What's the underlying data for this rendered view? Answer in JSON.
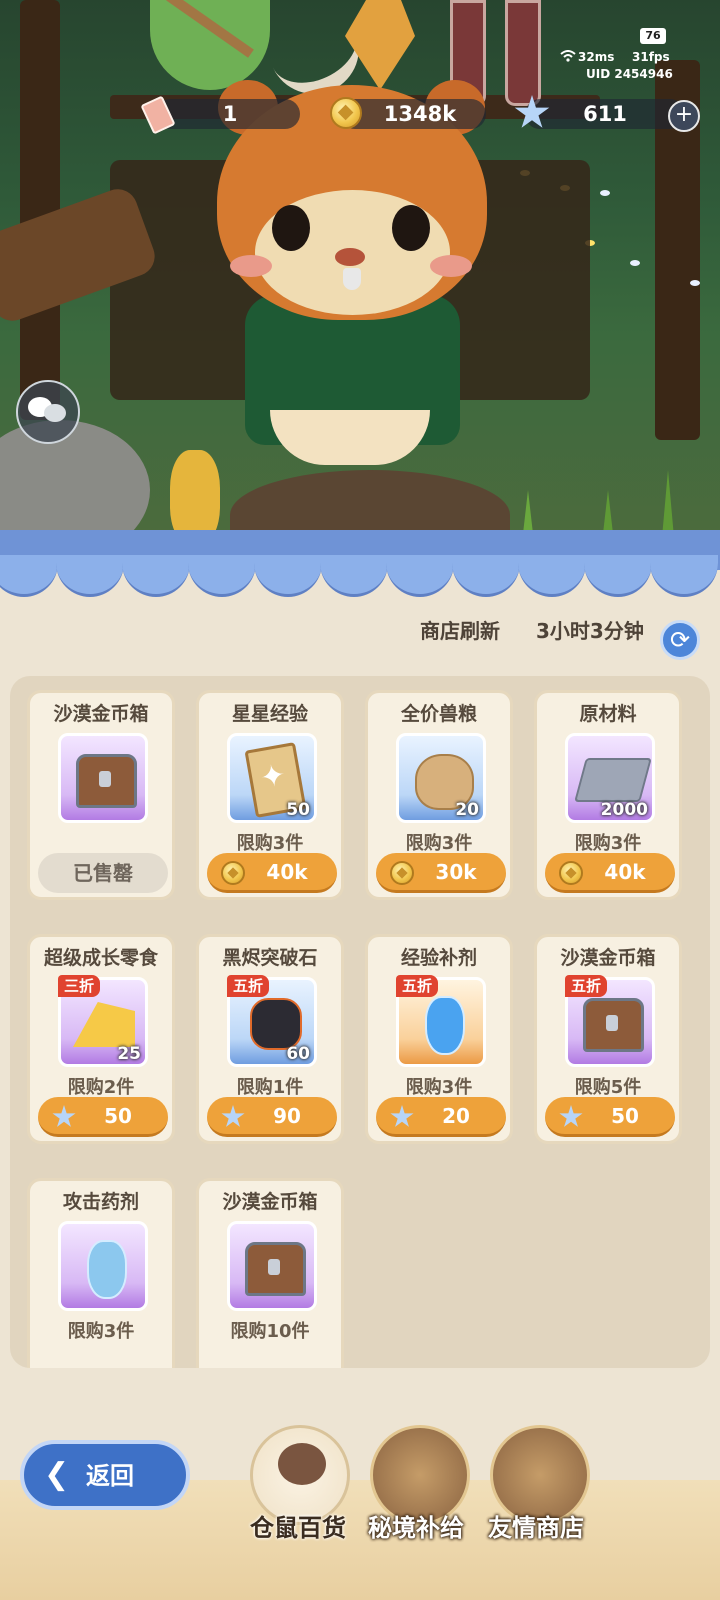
{
  "status": {
    "battery": "76",
    "ping": "32ms",
    "fps": "31fps",
    "uid": "UID 2454946"
  },
  "currency": {
    "tickets": "1",
    "coins": "1348k",
    "stars": "611"
  },
  "shop": {
    "refresh_label": "商店刷新",
    "refresh_time": "3小时3分钟",
    "items": [
      {
        "title": "沙漠金币箱",
        "qty": "",
        "limit": "",
        "price": "",
        "sold_label": "已售罄",
        "discount": ""
      },
      {
        "title": "星星经验",
        "qty": "50",
        "limit": "限购3件",
        "price": "40k",
        "discount": ""
      },
      {
        "title": "全价兽粮",
        "qty": "20",
        "limit": "限购3件",
        "price": "30k",
        "discount": ""
      },
      {
        "title": "原材料",
        "qty": "2000",
        "limit": "限购3件",
        "price": "40k",
        "discount": ""
      },
      {
        "title": "超级成长零食",
        "qty": "25",
        "limit": "限购2件",
        "price": "50",
        "discount": "三折"
      },
      {
        "title": "黑烬突破石",
        "qty": "60",
        "limit": "限购1件",
        "price": "90",
        "discount": "五折"
      },
      {
        "title": "经验补剂",
        "qty": "",
        "limit": "限购3件",
        "price": "20",
        "discount": "五折"
      },
      {
        "title": "沙漠金币箱",
        "qty": "",
        "limit": "限购5件",
        "price": "50",
        "discount": "五折"
      },
      {
        "title": "攻击药剂",
        "qty": "",
        "limit": "限购3件",
        "price": "",
        "discount": ""
      },
      {
        "title": "沙漠金币箱",
        "qty": "",
        "limit": "限购10件",
        "price": "",
        "discount": ""
      }
    ]
  },
  "nav": {
    "back_label": "返回",
    "tabs": [
      {
        "label": "仓鼠百货",
        "active": true
      },
      {
        "label": "秘境补给",
        "active": false
      },
      {
        "label": "友情商店",
        "active": false
      }
    ]
  },
  "colors": {
    "accent_blue": "#3e71c7",
    "price_orange": "#eea23a",
    "discount_red": "#e0432f",
    "panel_bg": "#ede4d3"
  },
  "icons": [
    "ticket-icon",
    "coin-icon",
    "star-gem-icon",
    "plus-icon",
    "chat-icon",
    "refresh-icon",
    "back-arrow-icon"
  ]
}
